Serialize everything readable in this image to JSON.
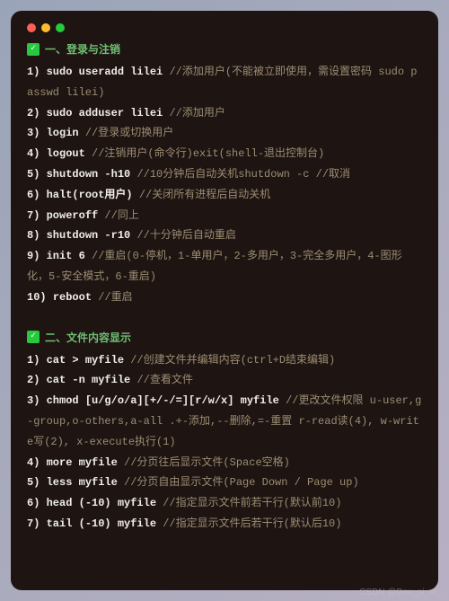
{
  "window": {
    "traffic_lights": [
      "close",
      "minimize",
      "zoom"
    ]
  },
  "sections": [
    {
      "title": "一、登录与注销",
      "items": [
        {
          "idx": "1)",
          "cmd": "sudo useradd lilei",
          "comment": "//添加用户(不能被立即使用，需设置密码 sudo passwd lilei)"
        },
        {
          "idx": "2)",
          "cmd": "sudo adduser lilei",
          "comment": "//添加用户"
        },
        {
          "idx": "3)",
          "cmd": "login",
          "comment": "//登录或切换用户"
        },
        {
          "idx": "4)",
          "cmd": "logout",
          "comment": "//注销用户(命令行)exit(shell-退出控制台)"
        },
        {
          "idx": "5)",
          "cmd": "shutdown -h10",
          "comment": "//10分钟后自动关机shutdown -c //取消"
        },
        {
          "idx": "6)",
          "cmd": "halt(root用户)",
          "comment": "//关闭所有进程后自动关机"
        },
        {
          "idx": "7)",
          "cmd": "poweroff",
          "comment": "//同上"
        },
        {
          "idx": "8)",
          "cmd": "shutdown -r10",
          "comment": "//十分钟后自动重启"
        },
        {
          "idx": "9)",
          "cmd": "init 6",
          "comment": "//重启(0-停机，1-单用户，2-多用户，3-完全多用户，4-图形化，5-安全模式，6-重启)"
        },
        {
          "idx": "10)",
          "cmd": "reboot",
          "comment": "//重启"
        }
      ]
    },
    {
      "title": "二、文件内容显示",
      "items": [
        {
          "idx": "1)",
          "cmd": "cat > myfile",
          "comment": "//创建文件并编辑内容(ctrl+D结束编辑)"
        },
        {
          "idx": "2)",
          "cmd": "cat -n myfile",
          "comment": "//查看文件"
        },
        {
          "idx": "3)",
          "cmd": "chmod [u/g/o/a][+/-/=][r/w/x] myfile",
          "comment": "//更改文件权限 u-user,g-group,o-others,a-all .+-添加,--删除,=-重置 r-read读(4), w-write写(2), x-execute执行(1)"
        },
        {
          "idx": "4)",
          "cmd": "more myfile",
          "comment": "//分页往后显示文件(Space空格)"
        },
        {
          "idx": "5)",
          "cmd": "less myfile",
          "comment": "//分页自由显示文件(Page Down / Page up)"
        },
        {
          "idx": "6)",
          "cmd": "head (-10) myfile",
          "comment": "//指定显示文件前若干行(默认前10)"
        },
        {
          "idx": "7)",
          "cmd": "tail (-10) myfile",
          "comment": "//指定显示文件后若干行(默认后10)"
        }
      ]
    }
  ],
  "watermark": "CSDN @Dex_ni_m_"
}
